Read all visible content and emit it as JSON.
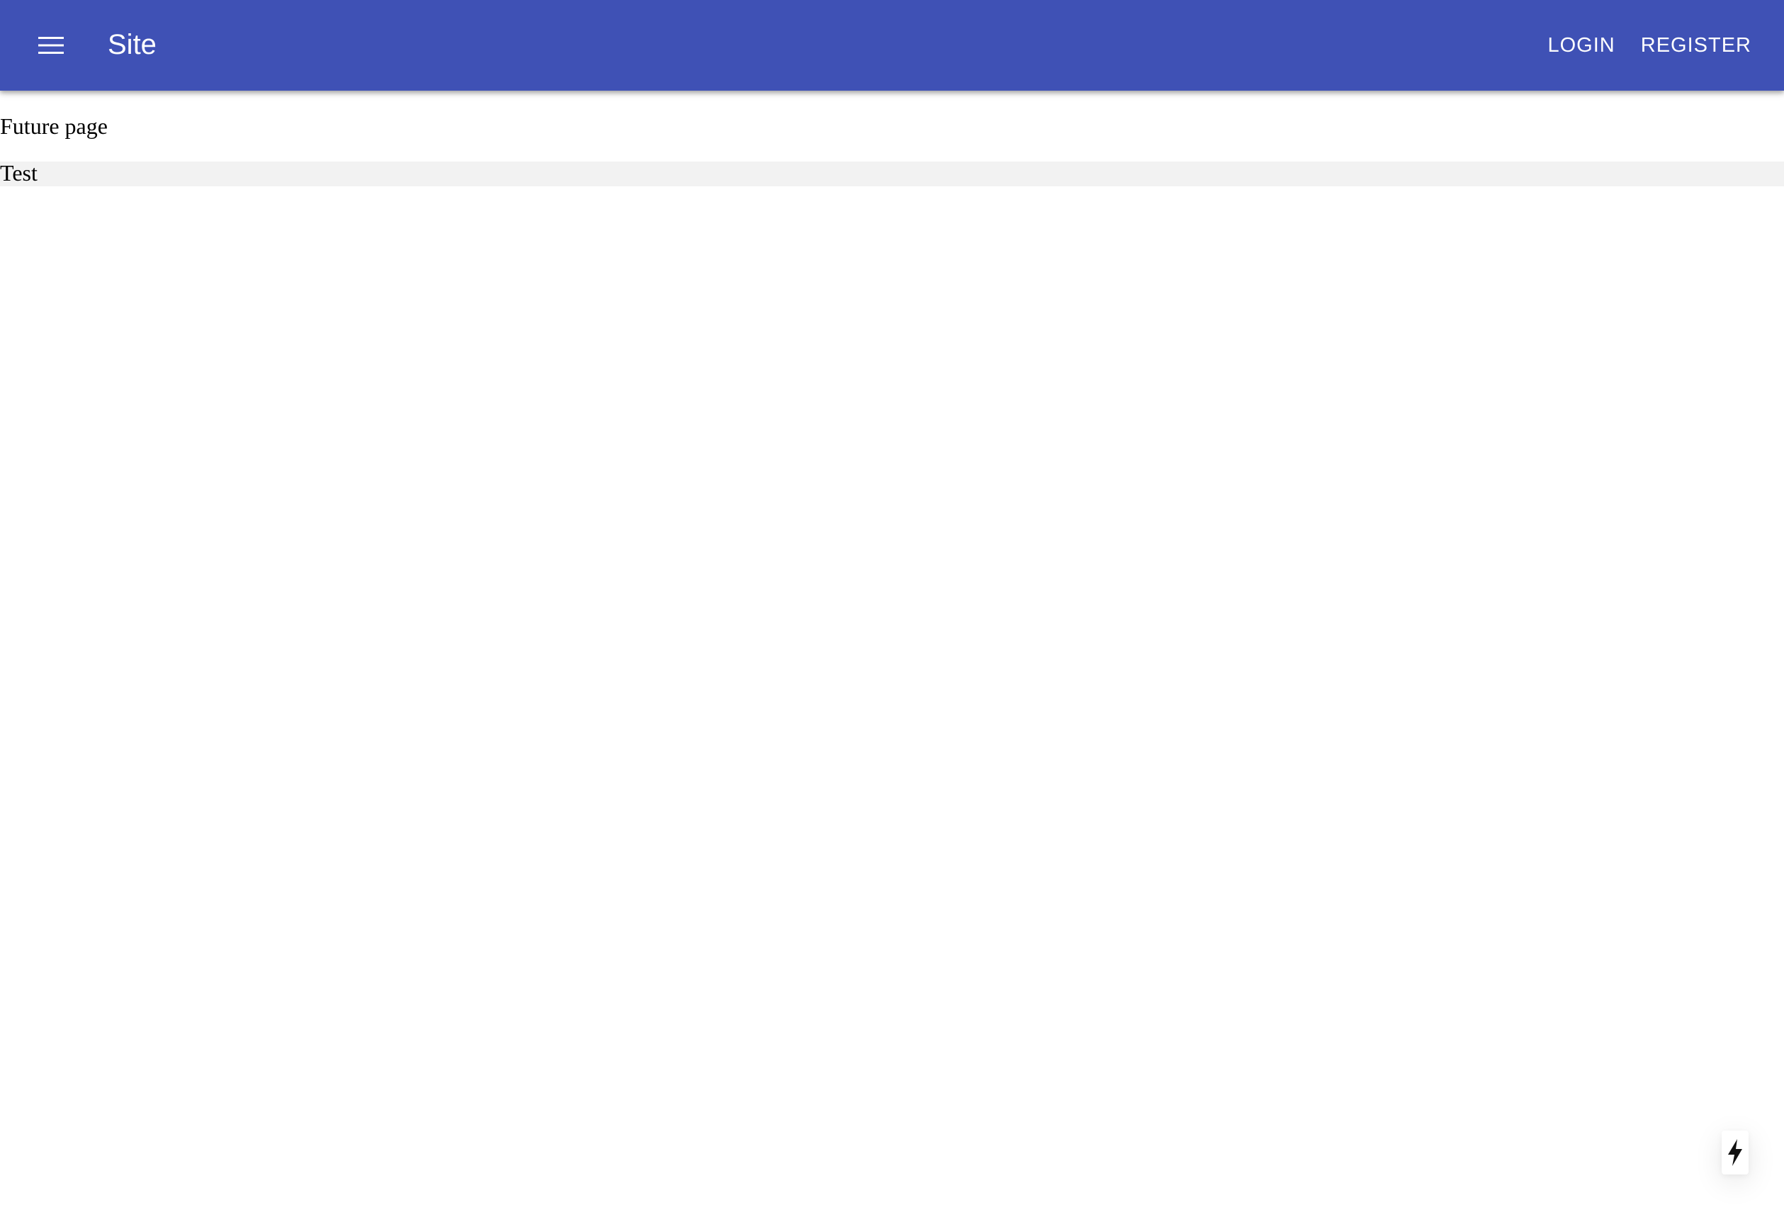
{
  "appbar": {
    "color": "#3f51b5",
    "menu_icon": "menu-icon",
    "title": "Site",
    "actions": [
      {
        "label": "LOGIN"
      },
      {
        "label": "REGISTER"
      }
    ]
  },
  "main": {
    "heading": "Future page",
    "row_text": "Test"
  },
  "floating": {
    "icon": "lightning-bolt-icon"
  }
}
